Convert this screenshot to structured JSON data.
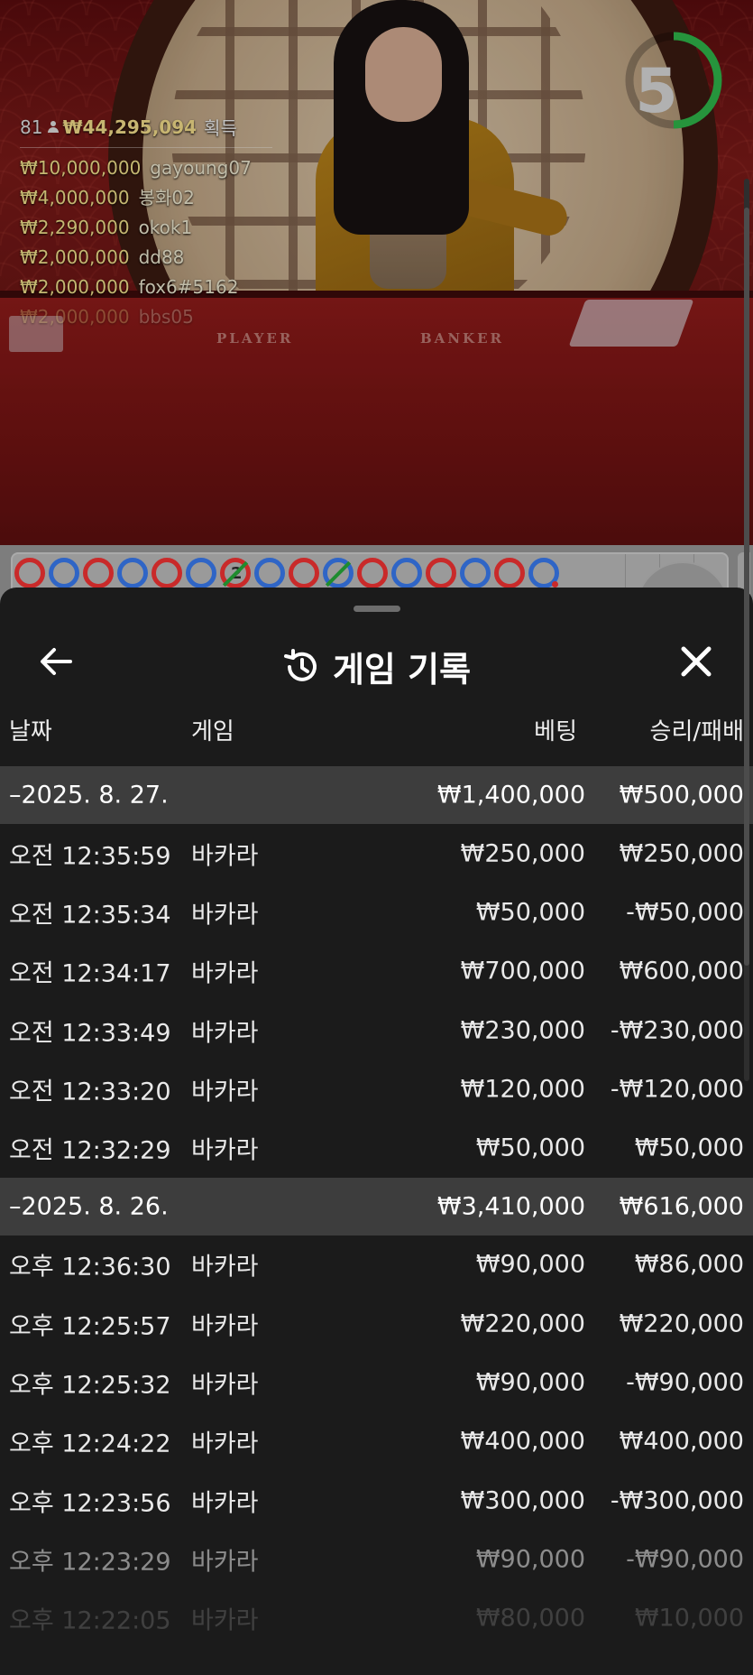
{
  "video": {
    "table_labels": {
      "player": "PLAYER",
      "banker": "BANKER"
    },
    "timer": {
      "value": "5",
      "progress": 0.5,
      "color": "#2fb54a"
    },
    "winners": {
      "count": "81",
      "total": "₩44,295,094",
      "label": "획득",
      "list": [
        {
          "amount": "₩10,000,000",
          "name": "gayoung07"
        },
        {
          "amount": "₩4,000,000",
          "name": "봉화02"
        },
        {
          "amount": "₩2,290,000",
          "name": "okok1"
        },
        {
          "amount": "₩2,000,000",
          "name": "dd88"
        },
        {
          "amount": "₩2,000,000",
          "name": "fox6#5162"
        },
        {
          "amount": "₩2,000,000",
          "name": "bbs05"
        }
      ]
    }
  },
  "road": {
    "results": [
      "R",
      "B",
      "R",
      "B",
      "R",
      "B",
      "R-2-slash",
      "B",
      "R",
      "B-slash",
      "R",
      "B",
      "R",
      "B",
      "R",
      "B-dot"
    ],
    "tie_count": "2",
    "colors": {
      "banker": "#c92a2a",
      "player": "#2f65c6",
      "tie": "#1f8c2f"
    }
  },
  "history": {
    "title": "게임 기록",
    "icons": {
      "back": "back-arrow-icon",
      "history": "history-clock-icon",
      "close": "close-icon"
    },
    "columns": {
      "date": "날짜",
      "game": "게임",
      "bet": "베팅",
      "win": "승리/패배"
    },
    "groups": [
      {
        "date": "–2025. 8. 27.",
        "bet_total": "₩1,400,000",
        "win_total": "₩500,000",
        "rows": [
          {
            "time": "오전 12:35:59",
            "game": "바카라",
            "bet": "₩250,000",
            "win": "₩250,000"
          },
          {
            "time": "오전 12:35:34",
            "game": "바카라",
            "bet": "₩50,000",
            "win": "-₩50,000"
          },
          {
            "time": "오전 12:34:17",
            "game": "바카라",
            "bet": "₩700,000",
            "win": "₩600,000"
          },
          {
            "time": "오전 12:33:49",
            "game": "바카라",
            "bet": "₩230,000",
            "win": "-₩230,000"
          },
          {
            "time": "오전 12:33:20",
            "game": "바카라",
            "bet": "₩120,000",
            "win": "-₩120,000"
          },
          {
            "time": "오전 12:32:29",
            "game": "바카라",
            "bet": "₩50,000",
            "win": "₩50,000"
          }
        ]
      },
      {
        "date": "–2025. 8. 26.",
        "bet_total": "₩3,410,000",
        "win_total": "₩616,000",
        "rows": [
          {
            "time": "오후 12:36:30",
            "game": "바카라",
            "bet": "₩90,000",
            "win": "₩86,000"
          },
          {
            "time": "오후 12:25:57",
            "game": "바카라",
            "bet": "₩220,000",
            "win": "₩220,000"
          },
          {
            "time": "오후 12:25:32",
            "game": "바카라",
            "bet": "₩90,000",
            "win": "-₩90,000"
          },
          {
            "time": "오후 12:24:22",
            "game": "바카라",
            "bet": "₩400,000",
            "win": "₩400,000"
          },
          {
            "time": "오후 12:23:56",
            "game": "바카라",
            "bet": "₩300,000",
            "win": "-₩300,000"
          },
          {
            "time": "오후 12:23:29",
            "game": "바카라",
            "bet": "₩90,000",
            "win": "-₩90,000"
          },
          {
            "time": "오후 12:22:05",
            "game": "바카라",
            "bet": "₩80,000",
            "win": "₩10,000"
          }
        ]
      }
    ]
  }
}
